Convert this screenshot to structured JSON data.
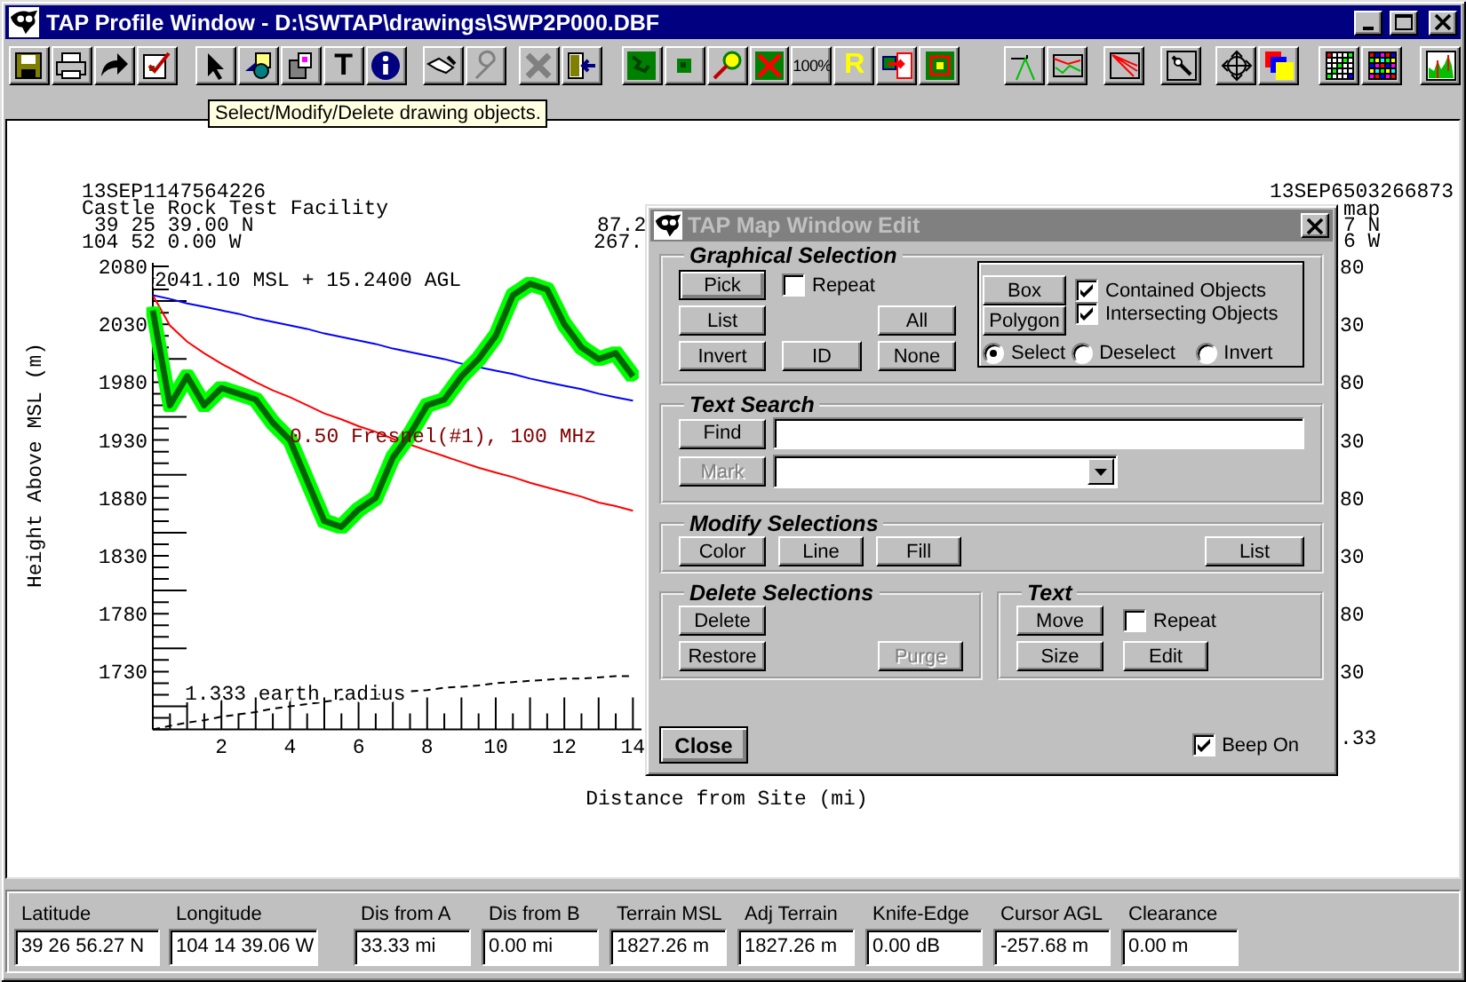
{
  "window": {
    "title": "TAP Profile Window - D:\\SWTAP\\drawings\\SWP2P000.DBF"
  },
  "toolbar": {
    "glyphs": [
      "T",
      "100%",
      "R"
    ]
  },
  "tooltip": "Select/Modify/Delete drawing objects.",
  "profile": {
    "site_a": [
      "13SEP1147564226",
      "Castle Rock Test Facility",
      "39 25 39.00 N",
      "104 52 0.00 W"
    ],
    "mid_values": [
      "87.2",
      "267."
    ],
    "site_b": [
      "13SEP6503266873",
      "map",
      "7 N",
      "6 W"
    ],
    "right_axis_labels": [
      "80",
      "30",
      "80",
      "30",
      "80",
      "30",
      "80",
      "30"
    ],
    "right_x_label": ".33",
    "chart_data": {
      "type": "line",
      "xlabel": "Distance from Site (mi)",
      "ylabel": "Height Above MSL (m)",
      "x": [
        0,
        0.5,
        1,
        1.5,
        2,
        2.5,
        3,
        3.5,
        4,
        4.5,
        5,
        5.5,
        6,
        6.5,
        7,
        7.5,
        8,
        8.5,
        9,
        9.5,
        10,
        10.5,
        11,
        11.5,
        12,
        12.5,
        13,
        13.5,
        14
      ],
      "series": [
        {
          "color": "#006400",
          "values": [
            2042,
            1960,
            1985,
            1960,
            1975,
            1970,
            1965,
            1945,
            1930,
            1895,
            1860,
            1855,
            1870,
            1880,
            1915,
            1935,
            1960,
            1965,
            1985,
            2000,
            2020,
            2055,
            2065,
            2060,
            2030,
            2010,
            2000,
            2005,
            1985
          ]
        },
        {
          "color": "#0000ff",
          "values": [
            2055,
            2052,
            2048,
            2045,
            2042,
            2039,
            2035,
            2032,
            2029,
            2026,
            2022,
            2019,
            2016,
            2013,
            2009,
            2006,
            2003,
            2000,
            1996,
            1993,
            1990,
            1987,
            1983,
            1980,
            1977,
            1974,
            1970,
            1967,
            1964
          ]
        },
        {
          "color": "#ff0000",
          "values": [
            2055,
            2029,
            2015,
            2005,
            1996,
            1988,
            1980,
            1973,
            1967,
            1960,
            1953,
            1948,
            1942,
            1937,
            1931,
            1926,
            1921,
            1916,
            1911,
            1906,
            1902,
            1898,
            1893,
            1889,
            1885,
            1881,
            1876,
            1873,
            1869
          ]
        },
        {
          "color": "#000000",
          "line_style": "dashed",
          "values": [
            1680,
            1683,
            1686,
            1688,
            1691,
            1693,
            1695,
            1698,
            1700,
            1702,
            1704,
            1706,
            1708,
            1710,
            1711,
            1713,
            1714,
            1716,
            1717,
            1718,
            1720,
            1721,
            1722,
            1723,
            1724,
            1724,
            1725,
            1726,
            1726
          ]
        }
      ],
      "xlim": [
        0,
        14.25
      ],
      "ylim": [
        1680,
        2080
      ],
      "xticks": [
        2,
        4,
        6,
        8,
        10,
        12,
        14
      ],
      "yticks": [
        1730,
        1780,
        1830,
        1880,
        1930,
        1980,
        2030,
        2080
      ],
      "annotations": [
        "2041.10 MSL + 15.2400 AGL",
        "0.50 Fresnel(#1), 100 MHz",
        "1.333 earth radius"
      ]
    }
  },
  "dialog": {
    "title": "TAP Map Window Edit",
    "graphical_selection": {
      "legend": "Graphical Selection",
      "pick": "Pick",
      "repeat": {
        "label": "Repeat",
        "checked": false
      },
      "list": "List",
      "all": "All",
      "invert": "Invert",
      "id": "ID",
      "none": "None",
      "box": "Box",
      "polygon": "Polygon",
      "contained": {
        "label": "Contained Objects",
        "checked": true
      },
      "intersecting": {
        "label": "Intersecting Objects",
        "checked": true
      },
      "modes": [
        {
          "label": "Select",
          "selected": true
        },
        {
          "label": "Deselect",
          "selected": false
        },
        {
          "label": "Invert",
          "selected": false
        }
      ]
    },
    "text_search": {
      "legend": "Text Search",
      "find": "Find",
      "mark": {
        "label": "Mark",
        "disabled": true
      }
    },
    "modify_selections": {
      "legend": "Modify Selections",
      "buttons": [
        "Color",
        "Line",
        "Fill",
        "List"
      ]
    },
    "delete_selections": {
      "legend": "Delete Selections",
      "delete": "Delete",
      "restore": "Restore",
      "purge": {
        "label": "Purge",
        "disabled": true
      }
    },
    "text": {
      "legend": "Text",
      "move": "Move",
      "repeat": {
        "label": "Repeat",
        "checked": false
      },
      "size": "Size",
      "edit": "Edit"
    },
    "close": "Close",
    "beep": {
      "label": "Beep On",
      "checked": true
    }
  },
  "status_bar": [
    {
      "label": "Latitude",
      "value": "39 26 56.27 N"
    },
    {
      "label": "Longitude",
      "value": "104 14 39.06 W"
    },
    {
      "label": "Dis from A",
      "value": "33.33 mi"
    },
    {
      "label": "Dis from B",
      "value": "0.00 mi"
    },
    {
      "label": "Terrain MSL",
      "value": "1827.26 m"
    },
    {
      "label": "Adj Terrain",
      "value": "1827.26 m"
    },
    {
      "label": "Knife-Edge",
      "value": "0.00 dB"
    },
    {
      "label": "Cursor AGL",
      "value": "-257.68 m"
    },
    {
      "label": "Clearance",
      "value": "0.00 m"
    }
  ]
}
